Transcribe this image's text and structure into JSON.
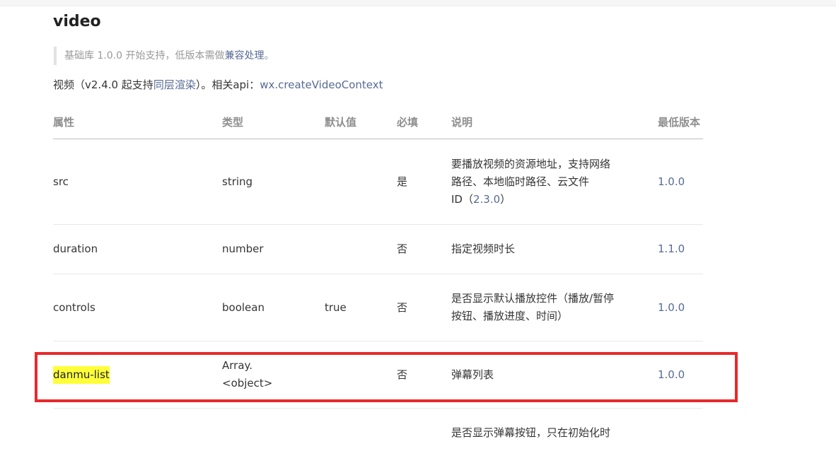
{
  "page": {
    "title": "video",
    "note": {
      "prefix": "基础库 1.0.0 开始支持，低版本需做",
      "link": "兼容处理",
      "suffix": "。"
    },
    "intro": {
      "prefix": "视频（v2.4.0 起支持",
      "link1": "同层渲染",
      "middle": "）。相关api：",
      "link2": "wx.createVideoContext"
    }
  },
  "table": {
    "headers": {
      "name": "属性",
      "type": "类型",
      "default": "默认值",
      "required": "必填",
      "desc": "说明",
      "version": "最低版本"
    },
    "rows": [
      {
        "name": "src",
        "type": "string",
        "default": "",
        "required": "是",
        "desc_line1": "要播放视频的资源地址，支持网络",
        "desc_line2": "路径、本地临时路径、云文件",
        "desc_line3": "ID（",
        "desc_link": "2.3.0",
        "desc_end": "）",
        "version": "1.0.0"
      },
      {
        "name": "duration",
        "type": "number",
        "default": "",
        "required": "否",
        "desc": "指定视频时长",
        "version": "1.1.0"
      },
      {
        "name": "controls",
        "type": "boolean",
        "default": "true",
        "required": "否",
        "desc_line1": "是否显示默认播放控件（播放/暂停",
        "desc_line2": "按钮、播放进度、时间）",
        "version": "1.0.0"
      },
      {
        "name": "danmu-list",
        "type_line1": "Array.",
        "type_line2": "<object>",
        "default": "",
        "required": "否",
        "desc": "弹幕列表",
        "version": "1.0.0"
      },
      {
        "desc_partial": "是否显示弹幕按钮，只在初始化时"
      }
    ]
  },
  "annotation": {
    "color": "#e8292b",
    "highlight_color": "#ffff3a"
  }
}
